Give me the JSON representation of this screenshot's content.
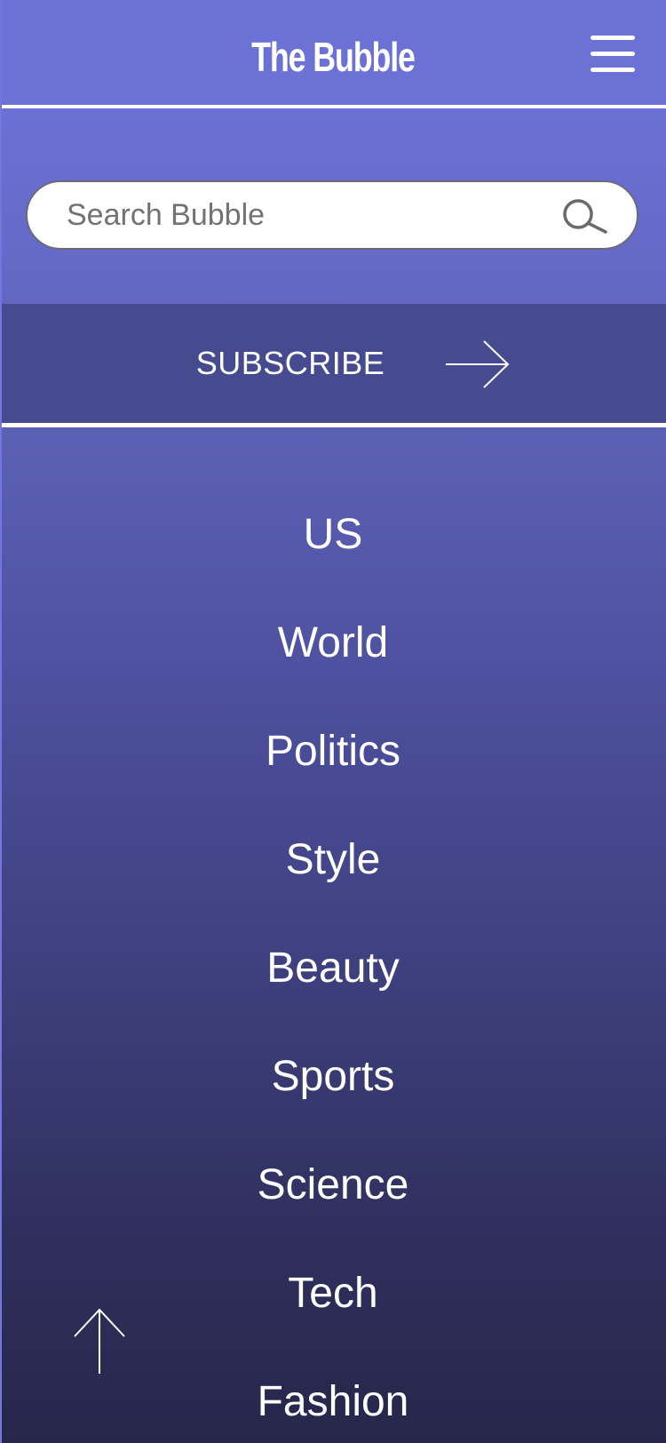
{
  "header": {
    "title": "The Bubble",
    "menu_icon": "hamburger-menu-icon"
  },
  "search": {
    "placeholder": "Search Bubble",
    "value": "",
    "icon": "search-icon"
  },
  "subscribe": {
    "label": "SUBSCRIBE",
    "icon": "arrow-right-icon"
  },
  "nav": {
    "items": [
      {
        "label": "US"
      },
      {
        "label": "World"
      },
      {
        "label": "Politics"
      },
      {
        "label": "Style"
      },
      {
        "label": "Beauty"
      },
      {
        "label": "Sports"
      },
      {
        "label": "Science"
      },
      {
        "label": "Tech"
      },
      {
        "label": "Fashion"
      }
    ]
  },
  "scroll_top": {
    "icon": "arrow-up-icon"
  },
  "colors": {
    "header_bg": "#6c71d6",
    "subscribe_bg": "#464a8f",
    "nav_top": "#5d61b6",
    "nav_bottom": "#27274b",
    "text": "#ffffff"
  }
}
